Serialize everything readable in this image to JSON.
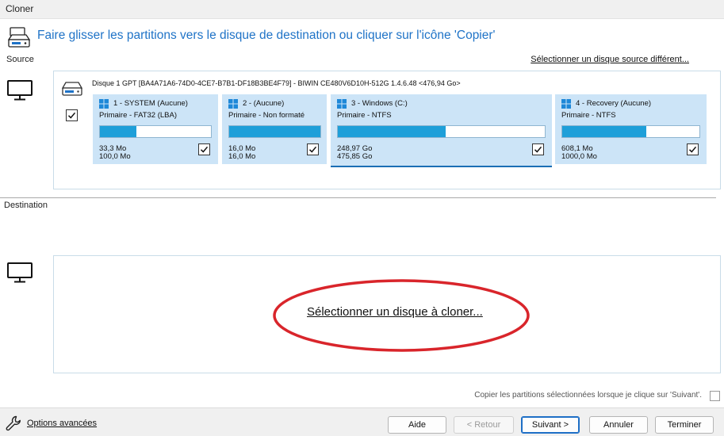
{
  "window": {
    "title": "Cloner"
  },
  "header": {
    "instruction": "Faire glisser les partitions vers le disque de destination ou cliquer sur l'icône  'Copier'"
  },
  "source": {
    "label": "Source",
    "select_other_link": "Sélectionner un disque source différent...",
    "disk": {
      "title": "Disque 1 GPT [BA4A71A6-74D0-4CE7-B7B1-DF18B3BE4F79] - BIWIN CE480V6D10H-512G 1.4.6.48  <476,94 Go>",
      "checked": true
    },
    "partitions": [
      {
        "name": "1 - SYSTEM (Aucune)",
        "type": "Primaire - FAT32 (LBA)",
        "used": "33,3 Mo",
        "total": "100,0 Mo",
        "fill": 0.33,
        "checked": true
      },
      {
        "name": "2 -  (Aucune)",
        "type": "Primaire - Non formaté",
        "used": "16,0 Mo",
        "total": "16,0 Mo",
        "fill": 1.0,
        "checked": true
      },
      {
        "name": "3 - Windows (C:)",
        "type": "Primaire - NTFS",
        "used": "248,97 Go",
        "total": "475,85 Go",
        "fill": 0.52,
        "checked": true
      },
      {
        "name": "4 - Recovery (Aucune)",
        "type": "Primaire - NTFS",
        "used": "608,1 Mo",
        "total": "1000,0 Mo",
        "fill": 0.61,
        "checked": true
      }
    ]
  },
  "destination": {
    "label": "Destination",
    "select_link": "Sélectionner un disque à cloner..."
  },
  "options": {
    "copy_on_next": "Copier les partitions sélectionnées lorsque je clique sur 'Suivant'.",
    "copy_on_next_checked": false,
    "advanced_link": "Options avancées"
  },
  "buttons": {
    "help": "Aide",
    "back": "< Retour",
    "next": "Suivant >",
    "cancel": "Annuler",
    "finish": "Terminer"
  },
  "colors": {
    "accent": "#1f73c7",
    "partition_bg": "#cce4f7",
    "bar_fill": "#1e9fd9",
    "annotation_ellipse": "#d9252b"
  },
  "icons": {
    "header": "disk-copy-icon",
    "source_monitor": "monitor-icon",
    "dest_monitor": "monitor-icon",
    "disk": "hard-disk-icon",
    "partition": "windows-logo-icon",
    "advanced": "wrench-icon"
  }
}
